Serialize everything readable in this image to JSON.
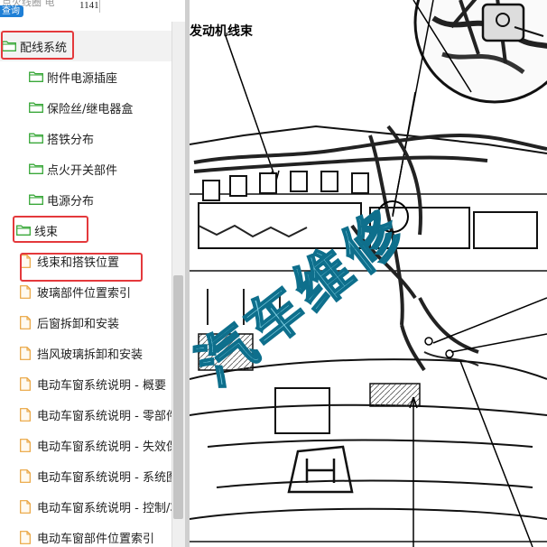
{
  "header": {
    "faded_text": "点火线圈 电",
    "number": "1141",
    "query_button": "查询"
  },
  "tree": {
    "items": [
      {
        "label": "配线系统",
        "type": "folder",
        "level": 0
      },
      {
        "label": "附件电源插座",
        "type": "folder",
        "level": 1
      },
      {
        "label": "保险丝/继电器盒",
        "type": "folder",
        "level": 1
      },
      {
        "label": "搭铁分布",
        "type": "folder",
        "level": 1
      },
      {
        "label": "点火开关部件",
        "type": "folder",
        "level": 1
      },
      {
        "label": "电源分布",
        "type": "folder",
        "level": 1
      },
      {
        "label": "线束",
        "type": "folder",
        "level": 1
      },
      {
        "label": "线束和搭铁位置",
        "type": "doc",
        "level": 2
      },
      {
        "label": "玻璃部件位置索引",
        "type": "doc",
        "level": 2
      },
      {
        "label": "后窗拆卸和安装",
        "type": "doc",
        "level": 2
      },
      {
        "label": "挡风玻璃拆卸和安装",
        "type": "doc",
        "level": 2
      },
      {
        "label": "电动车窗系统说明 - 概要",
        "type": "doc",
        "level": 2
      },
      {
        "label": "电动车窗系统说明 - 零部件",
        "type": "doc",
        "level": 2
      },
      {
        "label": "电动车窗系统说明 - 失效保护",
        "type": "doc",
        "level": 2
      },
      {
        "label": "电动车窗系统说明 - 系统图",
        "type": "doc",
        "level": 2
      },
      {
        "label": "电动车窗系统说明 - 控制/功能",
        "type": "doc",
        "level": 2
      },
      {
        "label": "电动车窗部件位置索引",
        "type": "doc",
        "level": 2
      }
    ]
  },
  "diagram": {
    "caption": "发动机线束",
    "watermark": "汽车维修"
  },
  "colors": {
    "highlight": "#e4393c",
    "folder_green": "#3aa83a",
    "doc_orange": "#e9a23b",
    "watermark": "#1e9fc4",
    "query_blue": "#1e7fd6"
  }
}
